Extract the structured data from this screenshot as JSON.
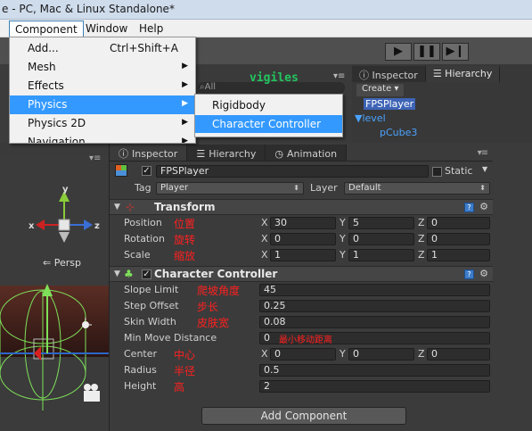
{
  "window": {
    "title": "e - PC, Mac & Linux Standalone*"
  },
  "menubar": {
    "items": [
      "Component",
      "Window",
      "Help"
    ]
  },
  "component_menu": {
    "items": [
      {
        "label": "Add...",
        "shortcut": "Ctrl+Shift+A",
        "submenu": false,
        "highlighted": false
      },
      {
        "label": "Mesh",
        "shortcut": "",
        "submenu": true,
        "highlighted": false
      },
      {
        "label": "Effects",
        "shortcut": "",
        "submenu": true,
        "highlighted": false
      },
      {
        "label": "Physics",
        "shortcut": "",
        "submenu": true,
        "highlighted": true
      },
      {
        "label": "Physics 2D",
        "shortcut": "",
        "submenu": true,
        "highlighted": false
      },
      {
        "label": "Navigation",
        "shortcut": "",
        "submenu": true,
        "highlighted": false
      }
    ]
  },
  "physics_submenu": {
    "items": [
      {
        "label": "Rigidbody",
        "highlighted": false
      },
      {
        "label": "Character Controller",
        "highlighted": true
      }
    ]
  },
  "watermark": "vigiles",
  "search": {
    "placeholder": "All"
  },
  "top_panel": {
    "tabs": [
      "Inspector",
      "Hierarchy"
    ],
    "create_label": "Create",
    "hierarchy_items": [
      "FPSPlayer",
      "level",
      "pCube3"
    ]
  },
  "scene": {
    "projection_label": "Persp"
  },
  "inspector": {
    "tabs": [
      "Inspector",
      "Hierarchy",
      "Animation"
    ],
    "object_name": "FPSPlayer",
    "static_label": "Static",
    "tag_label": "Tag",
    "tag_value": "Player",
    "layer_label": "Layer",
    "layer_value": "Default",
    "transform": {
      "title": "Transform",
      "rows": [
        {
          "label": "Position",
          "cn": "位置",
          "x": "30",
          "y": "5",
          "z": "0"
        },
        {
          "label": "Rotation",
          "cn": "旋转",
          "x": "0",
          "y": "0",
          "z": "0"
        },
        {
          "label": "Scale",
          "cn": "缩放",
          "x": "1",
          "y": "1",
          "z": "1"
        }
      ]
    },
    "character_controller": {
      "title": "Character Controller",
      "slope_limit": {
        "label": "Slope Limit",
        "cn": "爬坡角度",
        "value": "45"
      },
      "step_offset": {
        "label": "Step Offset",
        "cn": "步长",
        "value": "0.25"
      },
      "skin_width": {
        "label": "Skin Width",
        "cn": "皮肤宽",
        "value": "0.08"
      },
      "min_move_distance": {
        "label": "Min Move Distance",
        "cn": "最小移动距离",
        "value": "0"
      },
      "center": {
        "label": "Center",
        "cn": "中心",
        "x": "0",
        "y": "0",
        "z": "0"
      },
      "radius": {
        "label": "Radius",
        "cn": "半径",
        "value": "0.5"
      },
      "height": {
        "label": "Height",
        "cn": "高",
        "value": "2"
      }
    },
    "add_component_label": "Add Component"
  },
  "axis_labels": {
    "x": "X",
    "y": "Y",
    "z": "Z"
  },
  "colors": {
    "highlight": "#3399ff",
    "annotation": "#ff2020",
    "watermark": "#22c55e",
    "hierarchy_link": "#4aa3ff"
  }
}
